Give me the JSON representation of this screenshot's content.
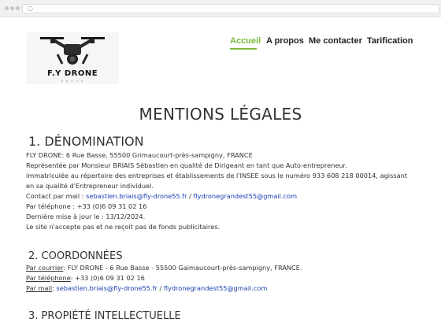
{
  "browser": {
    "url_glyph": "○"
  },
  "header": {
    "logo": {
      "brand": "F.Y DRONE",
      "tagline": "G·R·O·U·P"
    },
    "nav": [
      {
        "label": "Accueil",
        "active": true
      },
      {
        "label": "A propos",
        "active": false
      },
      {
        "label": "Me contacter",
        "active": false
      },
      {
        "label": "Tarification",
        "active": false
      }
    ]
  },
  "main": {
    "title": "MENTIONS LÉGALES",
    "section1": {
      "heading": "1. DÉNOMINATION",
      "lines": [
        "FLY DRONE: 6 Rue Basse, 55500 Grimaucourt-près-sampigny, FRANCE",
        "Représentée par Monsieur BRIAIS Sébastien en qualité de Dirigeant en tant que Auto-entrepreneur.",
        " immatriculée au répertoire des entreprises et établissements de l'INSEE sous le numéro 933 608 218 00014, agissant",
        "en sa qualité d'Entrepreneur individuel."
      ],
      "contact_mail_label": "Contact par mail : ",
      "contact_mail_1": "sebastien.briais@fly-drone55.fr",
      "contact_mail_sep": " / ",
      "contact_mail_2": "flydronegrandest55@gmail.com",
      "phone_line": "Par téléphone : +33 (0)6 09 31 02 16",
      "last_update": "Dernière mise à jour le : 13/12/2024.",
      "funds_line": "Le site n'accepte pas et ne reçoit pas de fonds publicitaires."
    },
    "section2": {
      "heading": "2. COORDONNÉES",
      "courier_label": "Par courrier",
      "courier_value": ": FLY DRONE - 6 Rue Basse - 55500 Gaimaucourt-près-sampigny, FRANCE.",
      "phone_label": "Par téléphone",
      "phone_value": ": +33 (0)6 09 31 02 16",
      "mail_label": "Par mail",
      "mail_sep_1": ": ",
      "mail_1": "sebastien.briais@fly-drone55.fr",
      "mail_sep_2": " / ",
      "mail_2": "flydronegrandest55@gmail.com"
    },
    "section3": {
      "heading": "3. PROPIÉTÉ INTELLECTUELLE"
    }
  },
  "colors": {
    "accent": "#79b93d",
    "link": "#1b3fb0",
    "text": "#333333"
  }
}
